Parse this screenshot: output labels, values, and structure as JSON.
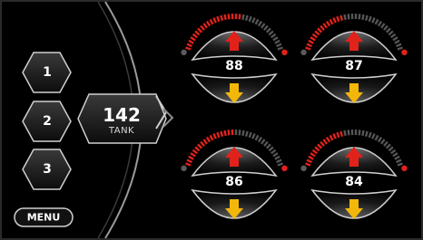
{
  "window": {
    "border_color": "#2a2a2a"
  },
  "colors": {
    "accent_red": "#e0221b",
    "accent_yellow": "#f2b70a",
    "outline": "#cfcfcf"
  },
  "presets": [
    {
      "label": "1"
    },
    {
      "label": "2"
    },
    {
      "label": "3"
    }
  ],
  "tank": {
    "value": "142",
    "label": "TANK"
  },
  "menu": {
    "label": "MENU"
  },
  "gauges": [
    {
      "id": "front-left",
      "value": "88",
      "level": 0.55
    },
    {
      "id": "front-right",
      "value": "87",
      "level": 0.4
    },
    {
      "id": "rear-left",
      "value": "86",
      "level": 0.5
    },
    {
      "id": "rear-right",
      "value": "84",
      "level": 0.4
    }
  ],
  "icons": {
    "up": "arrow-up-icon",
    "down": "arrow-down-icon",
    "status_dot": "status-dot-icon"
  }
}
